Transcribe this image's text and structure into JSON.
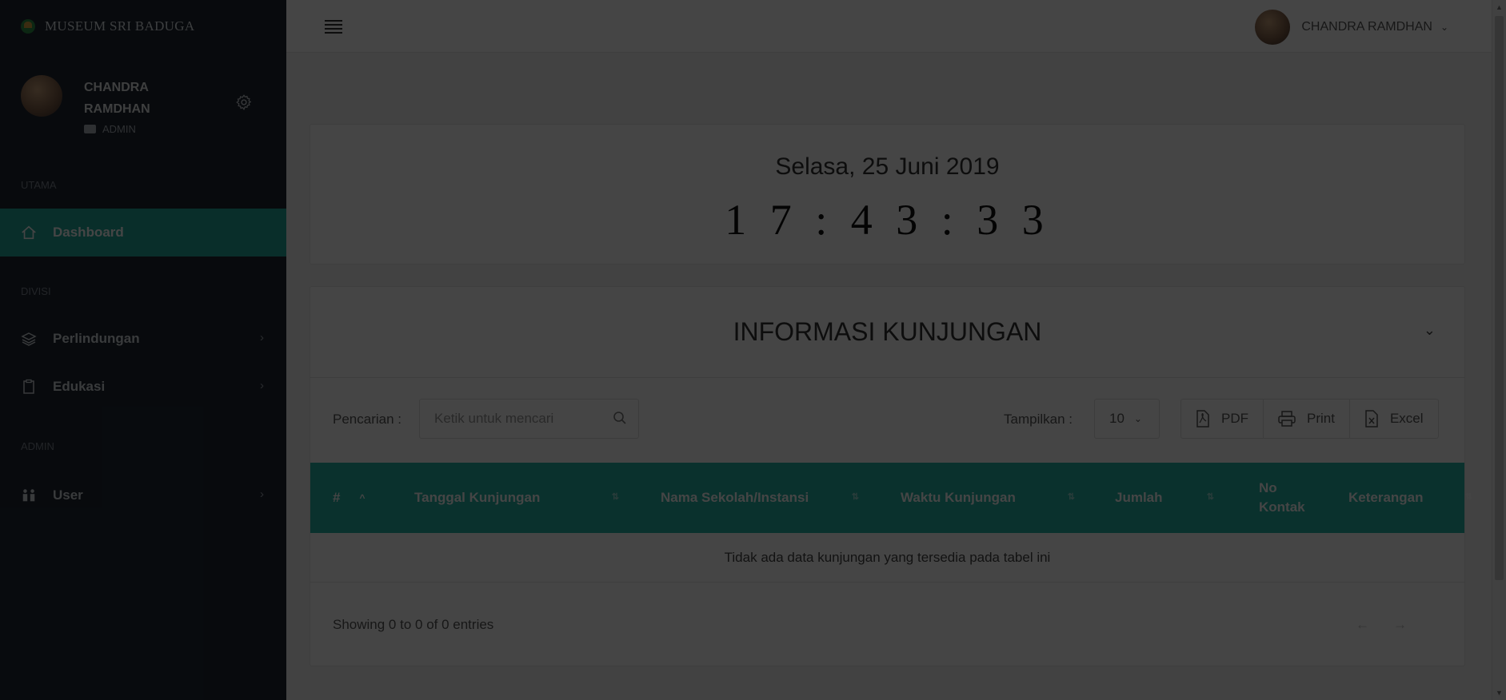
{
  "app": {
    "brand": "MUSEUM SRI BADUGA"
  },
  "sidebar": {
    "user_name": "CHANDRA RAMDHAN",
    "user_role": "ADMIN",
    "sections": [
      {
        "label": "UTAMA",
        "items": [
          {
            "label": "Dashboard",
            "icon": "home-icon",
            "active": true
          }
        ]
      },
      {
        "label": "DIVISI",
        "items": [
          {
            "label": "Perlindungan",
            "icon": "layers-icon"
          },
          {
            "label": "Edukasi",
            "icon": "clipboard-icon"
          }
        ]
      },
      {
        "label": "ADMIN",
        "items": [
          {
            "label": "User",
            "icon": "users-icon"
          }
        ]
      }
    ]
  },
  "topbar": {
    "user_name": "CHANDRA RAMDHAN"
  },
  "clock": {
    "date": "Selasa, 25 Juni 2019",
    "time": "17:43:33"
  },
  "info": {
    "title": "INFORMASI KUNJUNGAN",
    "search_label": "Pencarian :",
    "search_placeholder": "Ketik untuk mencari",
    "show_label": "Tampilkan :",
    "show_value": "10",
    "buttons": {
      "pdf": "PDF",
      "print": "Print",
      "excel": "Excel"
    },
    "columns": [
      "#",
      "Tanggal Kunjungan",
      "Nama Sekolah/Instansi",
      "Waktu Kunjungan",
      "Jumlah",
      "No Kontak",
      "Keterangan"
    ],
    "empty_message": "Tidak ada data kunjungan yang tersedia pada tabel ini",
    "footer": "Showing 0 to 0 of 0 entries",
    "pager": {
      "prev": "←",
      "next": "→"
    }
  },
  "colors": {
    "sidebar_bg": "#1e2733",
    "accent": "#26b5a6",
    "overlay": "rgba(0,0,0,0.73)"
  }
}
